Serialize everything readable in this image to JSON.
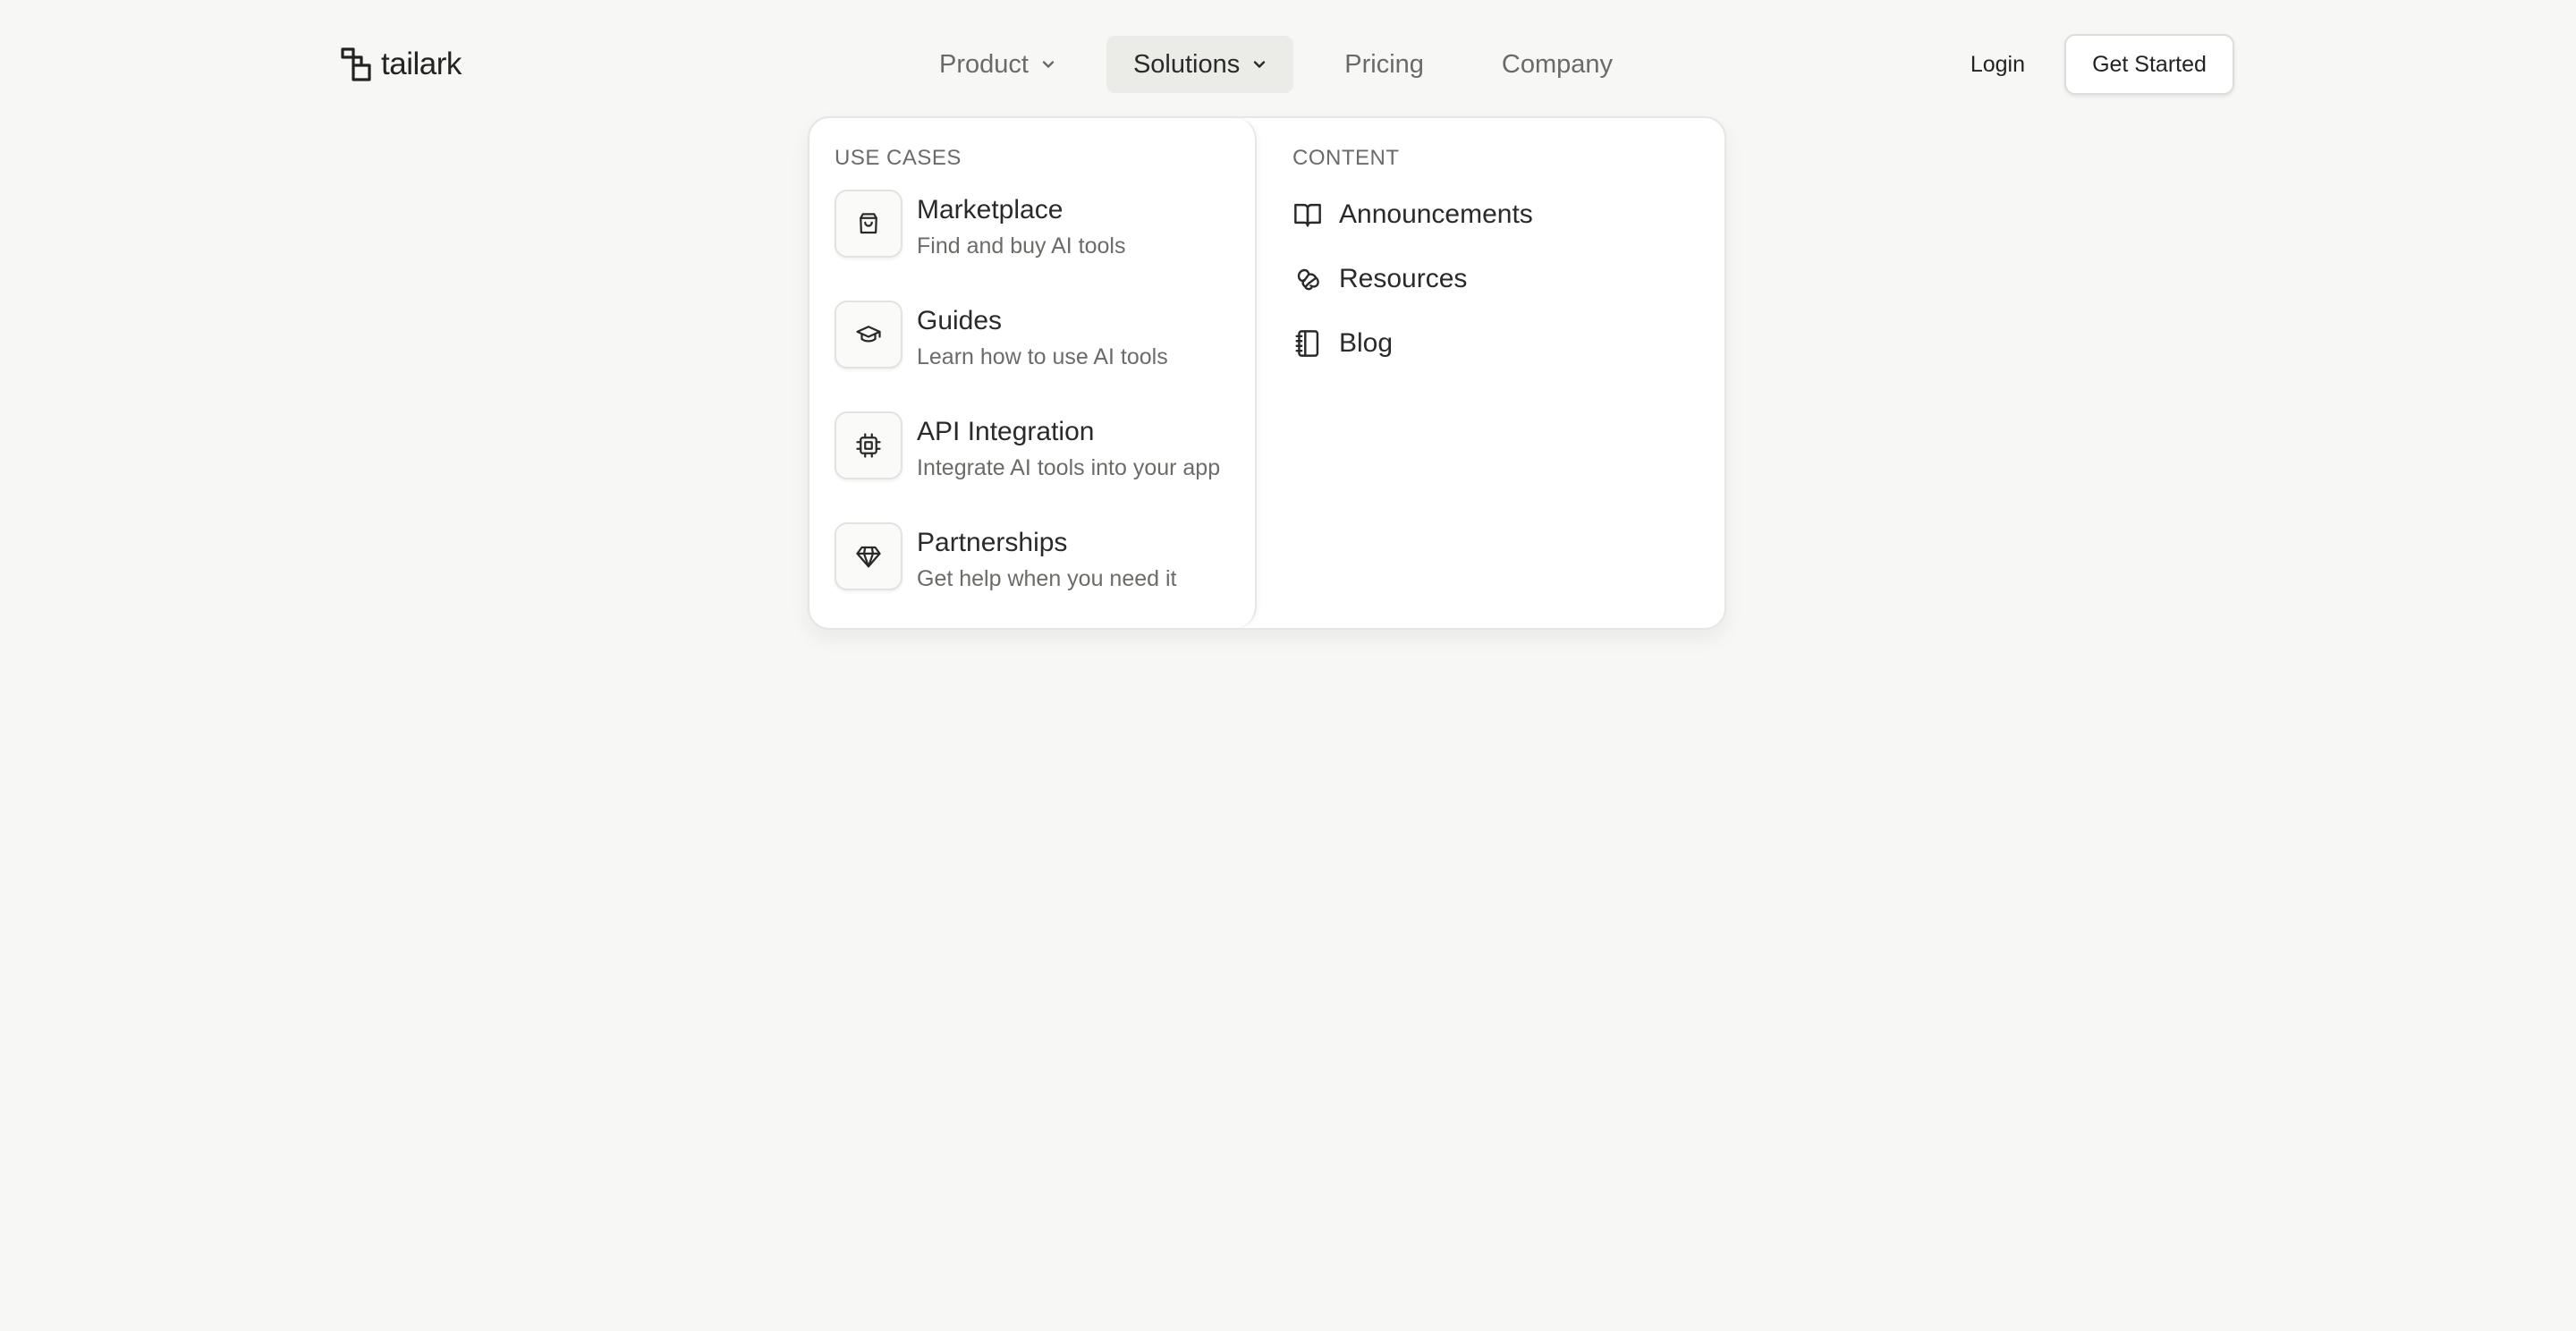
{
  "brand": {
    "name": "tailark"
  },
  "nav": {
    "items": [
      {
        "label": "Product",
        "has_dropdown": true,
        "active": false
      },
      {
        "label": "Solutions",
        "has_dropdown": true,
        "active": true
      },
      {
        "label": "Pricing",
        "has_dropdown": false,
        "active": false
      },
      {
        "label": "Company",
        "has_dropdown": false,
        "active": false
      }
    ]
  },
  "auth": {
    "login_label": "Login",
    "cta_label": "Get Started"
  },
  "dropdown": {
    "use_cases": {
      "title": "USE CASES",
      "items": [
        {
          "icon": "shopping-bag-icon",
          "title": "Marketplace",
          "description": "Find and buy AI tools"
        },
        {
          "icon": "graduation-cap-icon",
          "title": "Guides",
          "description": "Learn how to use AI tools"
        },
        {
          "icon": "cpu-chip-icon",
          "title": "API Integration",
          "description": "Integrate AI tools into your app"
        },
        {
          "icon": "gem-icon",
          "title": "Partnerships",
          "description": "Get help when you need it"
        }
      ]
    },
    "content": {
      "title": "CONTENT",
      "items": [
        {
          "icon": "book-open-icon",
          "label": "Announcements"
        },
        {
          "icon": "croissant-icon",
          "label": "Resources"
        },
        {
          "icon": "notebook-icon",
          "label": "Blog"
        }
      ]
    }
  },
  "colors": {
    "background": "#f7f7f6",
    "text": "#2a2a28",
    "muted_text": "#6b6b67",
    "active_nav_bg": "#ebebe8",
    "panel_bg": "#ffffff",
    "border": "#e6e6e3"
  }
}
